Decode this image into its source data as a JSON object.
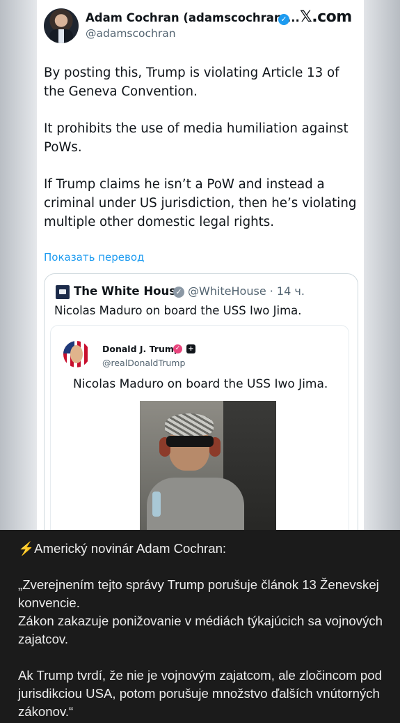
{
  "tweet": {
    "author_name": "Adam Cochran (adamscochran....",
    "author_handle": "@adamscochran",
    "site_label": "𝕏.com",
    "paragraphs": [
      "By posting this, Trump is violating Article 13 of the Geneva Convention.",
      "It prohibits the use of media humiliation against PoWs.",
      "If Trump claims he isn’t a PoW and instead a criminal under US jurisdiction, then he’s violating multiple other domestic legal rights."
    ],
    "translate_link": "Показать перевод"
  },
  "quoted": {
    "name": "The White House",
    "handle_time": "@WhiteHouse · 14 ч.",
    "text": "Nicolas Maduro on board the USS Iwo Jima.",
    "inner": {
      "name": "Donald J. Trump",
      "handle": "@realDonaldTrump",
      "text": "Nicolas Maduro on board the USS Iwo Jima."
    }
  },
  "caption": {
    "bolt": "⚡",
    "headline": "Americký novinár Adam Cochran:",
    "lines": [
      "„Zverejnením tejto správy Trump porušuje článok 13 Ženevskej konvencie.",
      "Zákon zakazuje ponižovanie v médiách týkajúcich sa vojnových zajatcov.",
      "Ak Trump tvrdí, že nie je vojnovým zajatcom, ale zločincom pod jurisdikciou USA, potom porušuje množstvo ďalších vnútorných zákonov.“"
    ]
  },
  "colors": {
    "accent_blue": "#1d9bf0",
    "caption_bg": "#1b1b1b",
    "bolt": "#f2c14e"
  }
}
